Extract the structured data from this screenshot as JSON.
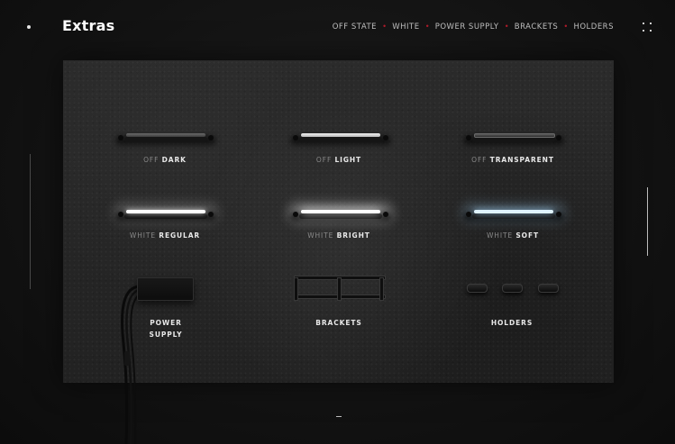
{
  "header": {
    "brand": "Extras",
    "nav": [
      "OFF STATE",
      "WHITE",
      "POWER SUPPLY",
      "BRACKETS",
      "HOLDERS"
    ],
    "nav_separator": "•",
    "menu_icon": "grid-dots-icon"
  },
  "colors": {
    "accent_separator": "#b01c2b",
    "background": "#121212",
    "board": "#262626",
    "white_soft_glow": "#bfe6ff",
    "white_regular_glow": "#ffffff"
  },
  "items": {
    "off_dark": {
      "prefix": "OFF",
      "name": "DARK"
    },
    "off_light": {
      "prefix": "OFF",
      "name": "LIGHT"
    },
    "off_transparent": {
      "prefix": "OFF",
      "name": "TRANSPARENT"
    },
    "white_regular": {
      "prefix": "WHITE",
      "name": "REGULAR"
    },
    "white_bright": {
      "prefix": "WHITE",
      "name": "BRIGHT"
    },
    "white_soft": {
      "prefix": "WHITE",
      "name": "SOFT"
    },
    "power_supply": {
      "line1": "POWER",
      "line2": "SUPPLY"
    },
    "brackets": {
      "label": "BRACKETS"
    },
    "holders": {
      "label": "HOLDERS"
    }
  }
}
